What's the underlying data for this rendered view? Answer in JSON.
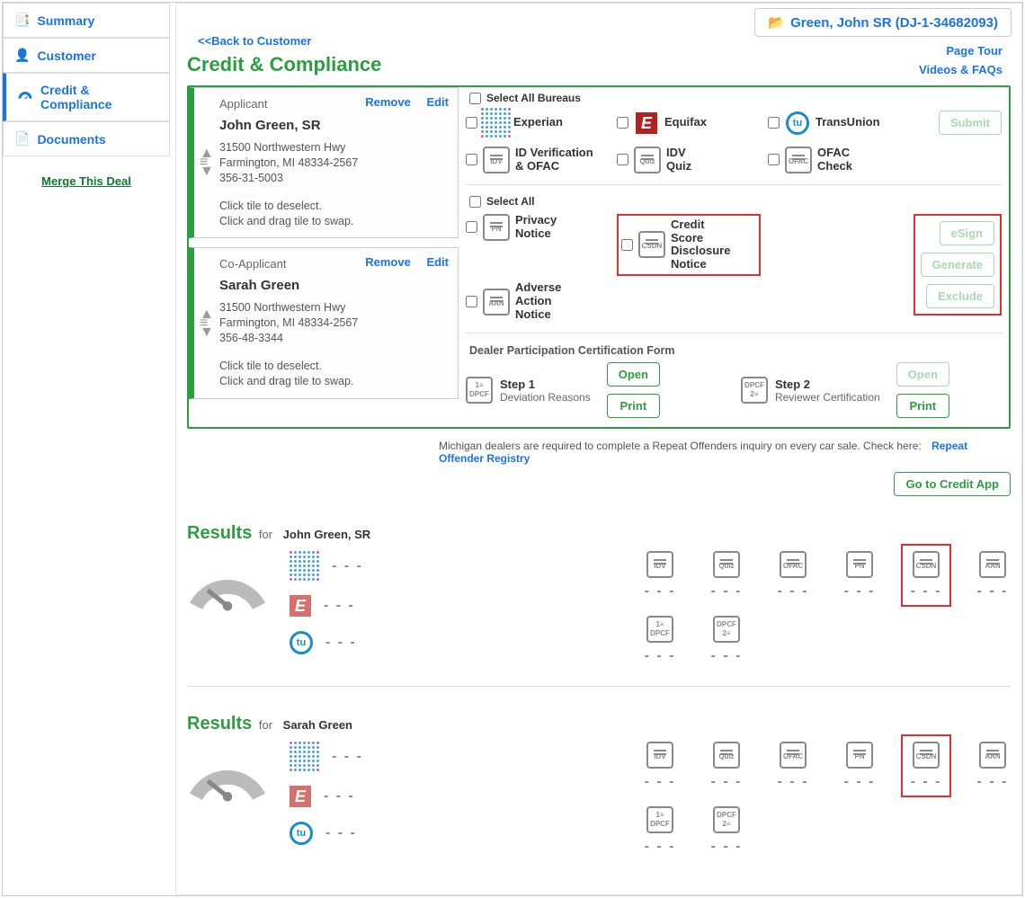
{
  "customer_pill": "Green, John SR (DJ-1-34682093)",
  "sidebar": {
    "summary": "Summary",
    "customer": "Customer",
    "credit": "Credit & Compliance",
    "documents": "Documents",
    "merge": "Merge This Deal"
  },
  "top": {
    "back": "<<Back to Customer",
    "title": "Credit & Compliance",
    "page_tour": "Page Tour",
    "videos": "Videos & FAQs"
  },
  "applicant": {
    "role": "Applicant",
    "remove": "Remove",
    "edit": "Edit",
    "name": "John Green, SR",
    "addr1": "31500 Northwestern Hwy",
    "addr2": "Farmington, MI 48334-2567",
    "ssn": "356-31-5003",
    "hint1": "Click tile to deselect.",
    "hint2": "Click and drag tile to swap."
  },
  "coapplicant": {
    "role": "Co-Applicant",
    "remove": "Remove",
    "edit": "Edit",
    "name": "Sarah Green",
    "addr1": "31500 Northwestern Hwy",
    "addr2": "Farmington, MI 48334-2567",
    "ssn": "356-48-3344",
    "hint1": "Click tile to deselect.",
    "hint2": "Click and drag tile to swap."
  },
  "bureaus": {
    "select_all": "Select All Bureaus",
    "experian": "Experian",
    "equifax": "Equifax",
    "transunion": "TransUnion",
    "idv": "ID Verification & OFAC",
    "idvquiz": "IDV Quiz",
    "ofac": "OFAC Check",
    "submit": "Submit"
  },
  "notices": {
    "select_all": "Select All",
    "privacy": "Privacy Notice",
    "csdn": "Credit Score Disclosure Notice",
    "aan": "Adverse Action Notice",
    "esign": "eSign",
    "generate": "Generate",
    "exclude": "Exclude"
  },
  "dpcf": {
    "title": "Dealer Participation Certification Form",
    "step1_t": "Step 1",
    "step1_s": "Deviation Reasons",
    "step2_t": "Step 2",
    "step2_s": "Reviewer Certification",
    "open": "Open",
    "print": "Print"
  },
  "note": {
    "text": "Michigan dealers are required to complete a Repeat Offenders inquiry on every car sale. Check here:",
    "link": "Repeat Offender Registry"
  },
  "go_credit": "Go to Credit App",
  "results_label": "Results",
  "for_label": "for",
  "res1_name": "John Green, SR",
  "res2_name": "Sarah Green",
  "dash": "- - -",
  "doc_labels": {
    "idv": "IDV",
    "quiz": "Quiz",
    "ofac": "OFAC",
    "pn": "PN",
    "csdn": "CSDN",
    "aan": "AAN",
    "dpcf1": "DPCF",
    "dpcf2": "DPCF"
  }
}
